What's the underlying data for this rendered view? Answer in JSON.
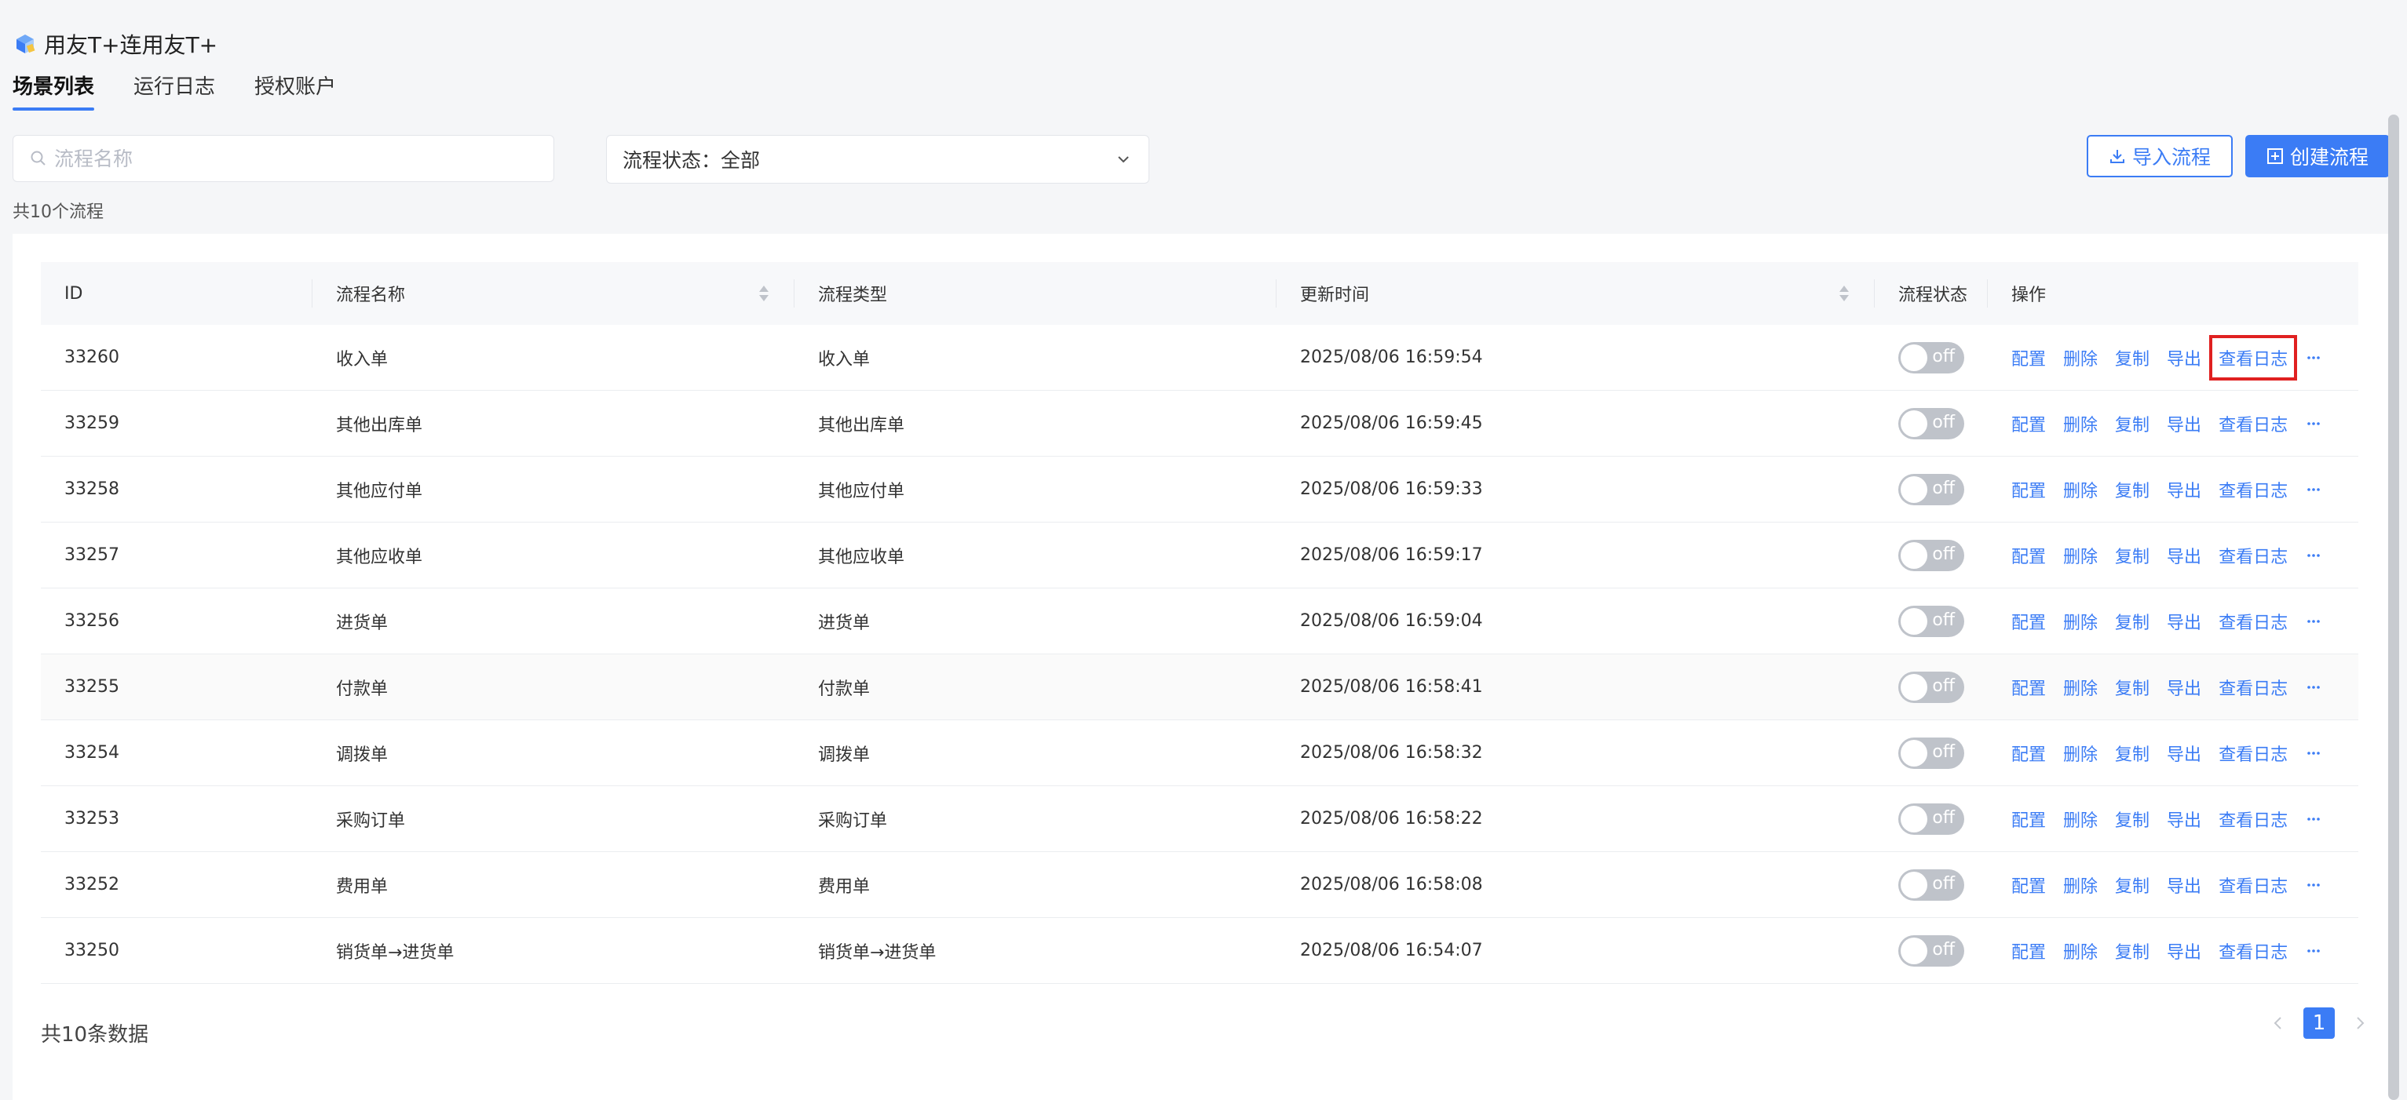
{
  "app": {
    "title": "用友T+连用友T+",
    "logo_icon": "cube-icon",
    "accent": "#3b7cf5"
  },
  "tabs": [
    {
      "label": "场景列表",
      "active": true
    },
    {
      "label": "运行日志",
      "active": false
    },
    {
      "label": "授权账户",
      "active": false
    }
  ],
  "filters": {
    "search_placeholder": "流程名称",
    "search_value": "",
    "status_label": "流程状态：全部"
  },
  "toolbar": {
    "import_label": "导入流程",
    "create_label": "创建流程"
  },
  "count_text": "共10个流程",
  "table": {
    "headers": [
      "ID",
      "流程名称",
      "流程类型",
      "更新时间",
      "流程状态",
      "操作"
    ],
    "ops": [
      "配置",
      "删除",
      "复制",
      "导出",
      "查看日志"
    ],
    "switch_label": "off",
    "rows": [
      {
        "id": "33260",
        "name": "收入单",
        "type": "收入单",
        "updated": "2025/08/06 16:59:54",
        "status": "off"
      },
      {
        "id": "33259",
        "name": "其他出库单",
        "type": "其他出库单",
        "updated": "2025/08/06 16:59:45",
        "status": "off"
      },
      {
        "id": "33258",
        "name": "其他应付单",
        "type": "其他应付单",
        "updated": "2025/08/06 16:59:33",
        "status": "off"
      },
      {
        "id": "33257",
        "name": "其他应收单",
        "type": "其他应收单",
        "updated": "2025/08/06 16:59:17",
        "status": "off"
      },
      {
        "id": "33256",
        "name": "进货单",
        "type": "进货单",
        "updated": "2025/08/06 16:59:04",
        "status": "off"
      },
      {
        "id": "33255",
        "name": "付款单",
        "type": "付款单",
        "updated": "2025/08/06 16:58:41",
        "status": "off"
      },
      {
        "id": "33254",
        "name": "调拨单",
        "type": "调拨单",
        "updated": "2025/08/06 16:58:32",
        "status": "off"
      },
      {
        "id": "33253",
        "name": "采购订单",
        "type": "采购订单",
        "updated": "2025/08/06 16:58:22",
        "status": "off"
      },
      {
        "id": "33252",
        "name": "费用单",
        "type": "费用单",
        "updated": "2025/08/06 16:58:08",
        "status": "off"
      },
      {
        "id": "33250",
        "name": "销货单→进货单",
        "type": "销货单→进货单",
        "updated": "2025/08/06 16:54:07",
        "status": "off"
      }
    ]
  },
  "footer": {
    "total_text": "共10条数据",
    "current_page": "1"
  }
}
